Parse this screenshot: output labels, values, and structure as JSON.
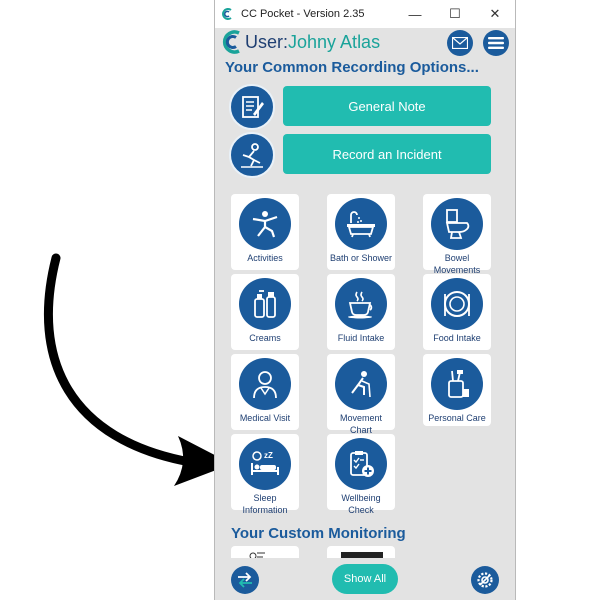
{
  "window": {
    "title": "CC Pocket - Version 2.35",
    "controls": {
      "minimize": "—",
      "maximize": "☐",
      "close": "✕"
    }
  },
  "header": {
    "user_prefix": "User:",
    "user_name": "Johny Atlas",
    "mail_icon": "mail-icon",
    "menu_icon": "menu-icon"
  },
  "common": {
    "title": "Your Common Recording Options...",
    "buttons": [
      {
        "label": "General Note",
        "icon": "note-icon"
      },
      {
        "label": "Record an Incident",
        "icon": "incident-icon"
      }
    ]
  },
  "tiles": [
    {
      "label": "Activities",
      "icon": "activities-icon"
    },
    {
      "label": "Bath or Shower",
      "icon": "bath-icon"
    },
    {
      "label": "Bowel Movements",
      "icon": "toilet-icon"
    },
    {
      "label": "Creams",
      "icon": "creams-icon"
    },
    {
      "label": "Fluid Intake",
      "icon": "cup-icon"
    },
    {
      "label": "Food Intake",
      "icon": "plate-icon"
    },
    {
      "label": "Medical Visit",
      "icon": "doctor-icon"
    },
    {
      "label": "Movement Chart",
      "icon": "movement-icon"
    },
    {
      "label": "Personal Care",
      "icon": "toothbrush-icon"
    },
    {
      "label": "Sleep Information",
      "icon": "sleep-icon"
    },
    {
      "label": "Wellbeing Check",
      "icon": "clipboard-icon"
    }
  ],
  "custom": {
    "title": "Your Custom Monitoring"
  },
  "bottom": {
    "show_all": "Show All",
    "left_icon": "swap-arrows-icon",
    "right_icon": "settings-icon"
  },
  "colors": {
    "brand_blue": "#1b5b9c",
    "teal": "#21bcb0",
    "background": "#e3e3e3"
  }
}
